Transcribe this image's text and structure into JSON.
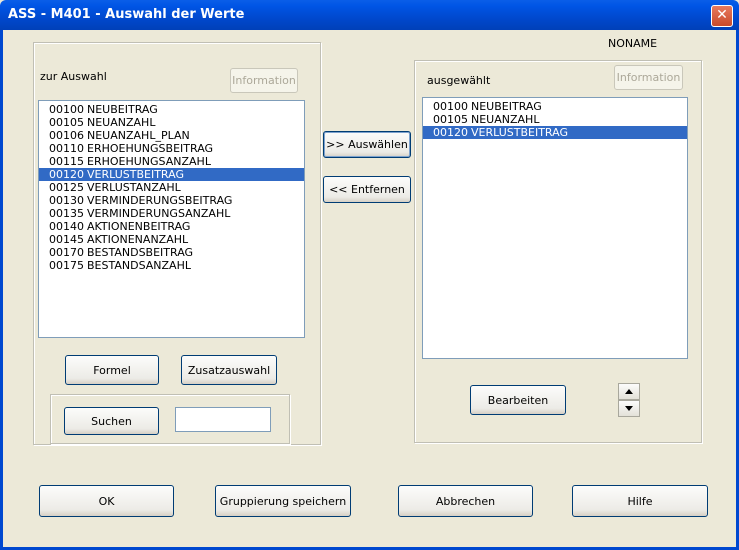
{
  "window": {
    "title": "ASS - M401 - Auswahl der Werte",
    "close_glyph": "✕"
  },
  "noname": "NONAME",
  "left": {
    "label": "zur Auswahl",
    "info_button": "Information",
    "items": [
      {
        "code": "00100",
        "name": "NEUBEITRAG"
      },
      {
        "code": "00105",
        "name": "NEUANZAHL"
      },
      {
        "code": "00106",
        "name": "NEUANZAHL_PLAN"
      },
      {
        "code": "00110",
        "name": "ERHOEHUNGSBEITRAG"
      },
      {
        "code": "00115",
        "name": "ERHOEHUNGSANZAHL"
      },
      {
        "code": "00120",
        "name": "VERLUSTBEITRAG"
      },
      {
        "code": "00125",
        "name": "VERLUSTANZAHL"
      },
      {
        "code": "00130",
        "name": "VERMINDERUNGSBEITRAG"
      },
      {
        "code": "00135",
        "name": "VERMINDERUNGSANZAHL"
      },
      {
        "code": "00140",
        "name": "AKTIONENBEITRAG"
      },
      {
        "code": "00145",
        "name": "AKTIONENANZAHL"
      },
      {
        "code": "00170",
        "name": "BESTANDSBEITRAG"
      },
      {
        "code": "00175",
        "name": "BESTANDSANZAHL"
      }
    ],
    "selected_index": 5,
    "formel_button": "Formel",
    "zusatz_button": "Zusatzauswahl",
    "suchen_button": "Suchen",
    "search_value": ""
  },
  "middle": {
    "add_button": ">> Auswählen",
    "remove_button": "<< Entfernen"
  },
  "right": {
    "label": "ausgewählt",
    "info_button": "Information",
    "items": [
      {
        "code": "00100",
        "name": "NEUBEITRAG"
      },
      {
        "code": "00105",
        "name": "NEUANZAHL"
      },
      {
        "code": "00120",
        "name": "VERLUSTBEITRAG"
      }
    ],
    "selected_index": 2,
    "edit_button": "Bearbeiten"
  },
  "footer": {
    "ok_button": "OK",
    "save_group_button": "Gruppierung speichern",
    "cancel_button": "Abbrechen",
    "help_button": "Hilfe"
  },
  "colors": {
    "selection": "#316ac5",
    "titlebar": "#0055e5",
    "dialog_bg": "#ece9d8"
  }
}
